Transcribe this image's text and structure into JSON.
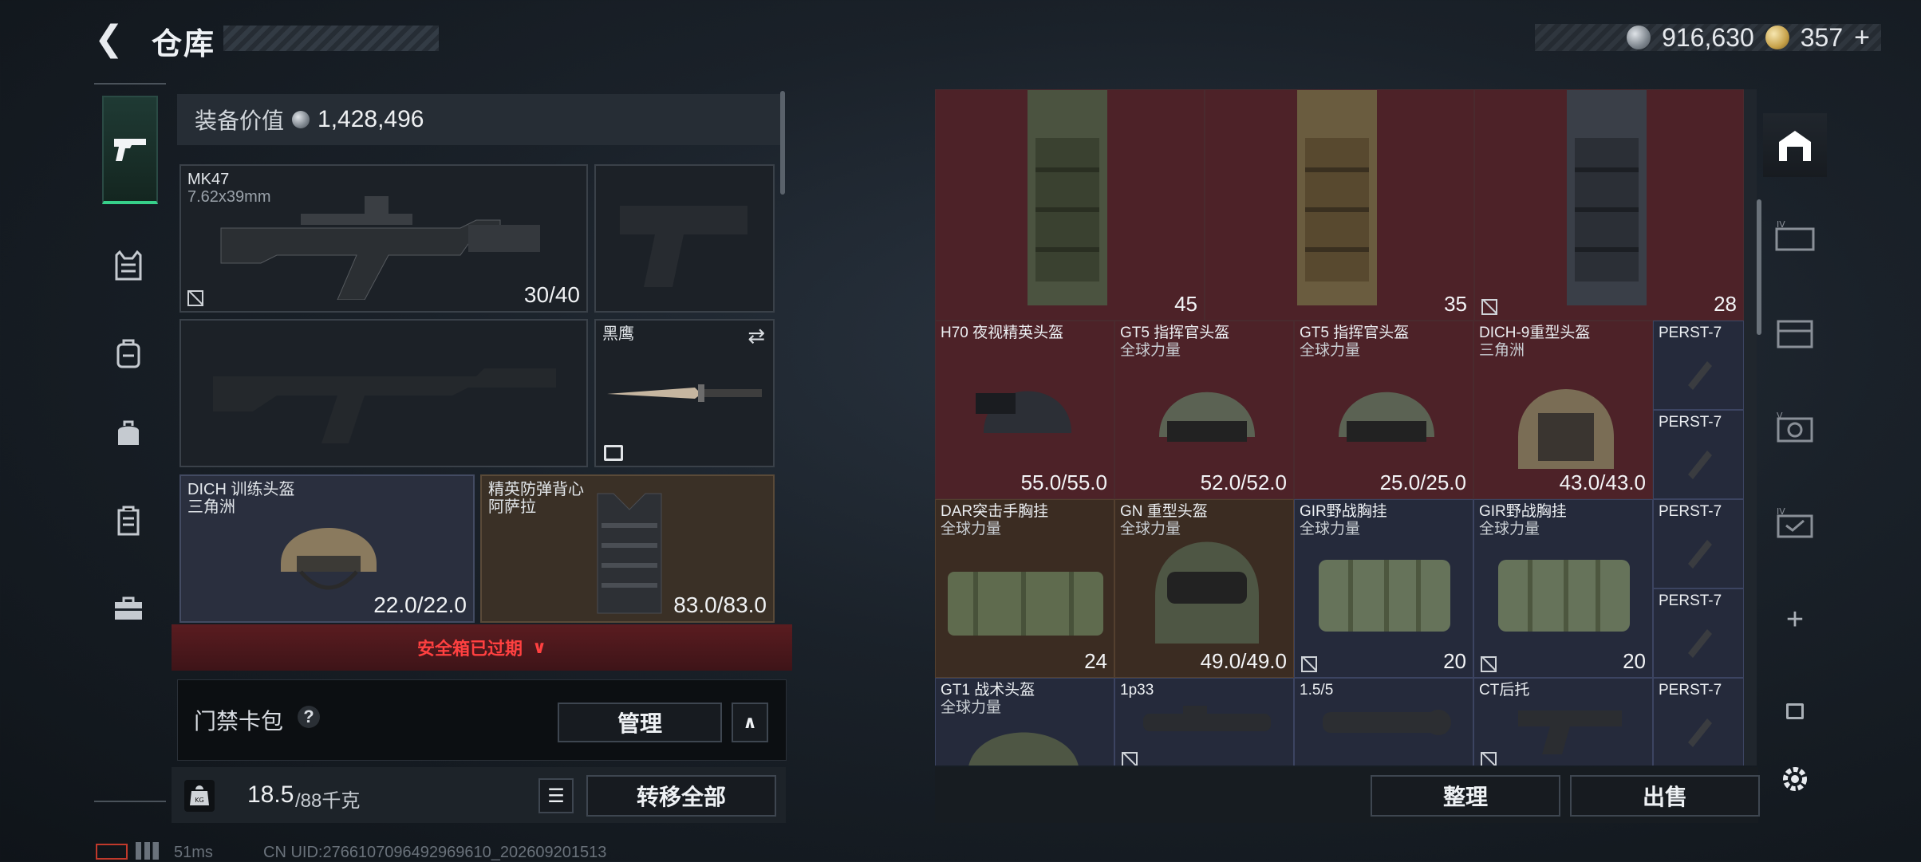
{
  "header": {
    "title": "仓库",
    "currency_silver": "916,630",
    "currency_gold": "357",
    "currency_add": "+"
  },
  "rail_icons": [
    "pistol-icon",
    "vest-icon",
    "backpack-icon",
    "bag-icon",
    "case-icon",
    "toolbox-icon"
  ],
  "equipment": {
    "value_label": "装备价值",
    "value": "1,428,496",
    "primary": {
      "name": "MK47",
      "ammo": "7.62x39mm",
      "durability": "30/40"
    },
    "melee": {
      "name": "黑鹰"
    },
    "helmet": {
      "name": "DICH 训练头盔",
      "origin": "三角洲",
      "durability": "22.0/22.0"
    },
    "armor": {
      "name": "精英防弹背心",
      "origin": "阿萨拉",
      "durability": "83.0/83.0"
    },
    "safebox_text": "安全箱已过期",
    "cardpack_label": "门禁卡包",
    "cardpack_help": "?",
    "manage_label": "管理",
    "weight_current": "18.5",
    "weight_max": "/88千克",
    "transfer_all": "转移全部"
  },
  "stash": {
    "top_row": [
      {
        "count": "45"
      },
      {
        "count": "35"
      },
      {
        "count": "28"
      }
    ],
    "row2": [
      {
        "name": "H70 夜视精英头盔",
        "sub": "",
        "value": "55.0/55.0"
      },
      {
        "name": "GT5 指挥官头盔",
        "sub": "全球力量",
        "value": "52.0/52.0"
      },
      {
        "name": "GT5 指挥官头盔",
        "sub": "全球力量",
        "value": "25.0/25.0"
      },
      {
        "name": "DICH-9重型头盔",
        "sub": "三角洲",
        "value": "43.0/43.0"
      }
    ],
    "row3": [
      {
        "name": "DAR突击手胸挂",
        "sub": "全球力量",
        "value": "24"
      },
      {
        "name": "GN 重型头盔",
        "sub": "全球力量",
        "value": "49.0/49.0"
      },
      {
        "name": "GIR野战胸挂",
        "sub": "全球力量",
        "value": "20"
      },
      {
        "name": "GIR野战胸挂",
        "sub": "全球力量",
        "value": "20"
      }
    ],
    "row4": [
      {
        "name": "GT1 战术头盔",
        "sub": "全球力量"
      },
      {
        "name": "1p33",
        "sub": ""
      },
      {
        "name": "1.5/5",
        "sub": ""
      },
      {
        "name": "CT后托",
        "sub": ""
      }
    ],
    "side_items": [
      "PERST-7",
      "PERST-7",
      "PERST-7",
      "PERST-7",
      "PERST-7"
    ],
    "sort_label": "整理",
    "sell_label": "出售",
    "add_label": "+"
  },
  "status_bar": {
    "ping": "51ms",
    "uid": "CN UID:2766107096492969610_202609201513"
  }
}
